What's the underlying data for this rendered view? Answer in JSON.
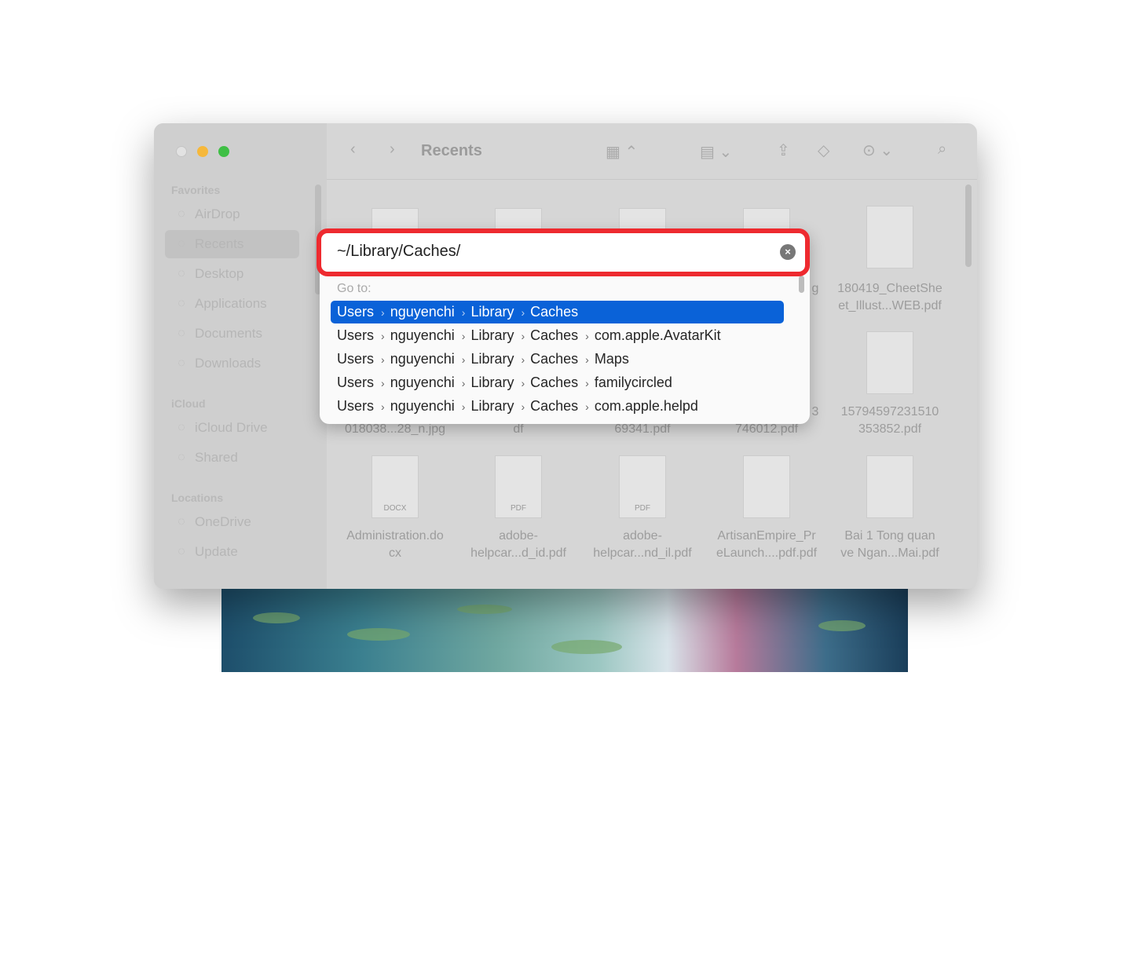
{
  "window": {
    "title": "Recents"
  },
  "sidebar": {
    "sections": [
      {
        "label": "Favorites",
        "items": [
          {
            "label": "AirDrop",
            "icon": "airdrop-icon"
          },
          {
            "label": "Recents",
            "icon": "clock-icon",
            "selected": true
          },
          {
            "label": "Desktop",
            "icon": "desktop-icon"
          },
          {
            "label": "Applications",
            "icon": "applications-icon"
          },
          {
            "label": "Documents",
            "icon": "document-icon"
          },
          {
            "label": "Downloads",
            "icon": "download-icon"
          }
        ]
      },
      {
        "label": "iCloud",
        "items": [
          {
            "label": "iCloud Drive",
            "icon": "cloud-icon"
          },
          {
            "label": "Shared",
            "icon": "shared-folder-icon"
          }
        ]
      },
      {
        "label": "Locations",
        "items": [
          {
            "label": "OneDrive",
            "icon": "cloud-icon"
          },
          {
            "label": "Update",
            "icon": "drive-icon"
          }
        ]
      }
    ]
  },
  "files": {
    "row1": [
      {
        "name": "180419_CheetShe\net_Illust...WEB.pdf"
      }
    ],
    "row1_partial": "g",
    "row2": [
      {
        "name": "018038...28_n.jpg"
      },
      {
        "name": "df"
      },
      {
        "name": "69341.pdf"
      },
      {
        "name": "746012.pdf"
      },
      {
        "name": "15794597231510\n353852.pdf"
      }
    ],
    "row2_partial": "3",
    "row3": [
      {
        "name": "Administration.do\ncx",
        "badge": "DOCX"
      },
      {
        "name": "adobe-\nhelpcar...d_id.pdf",
        "badge": "PDF"
      },
      {
        "name": "adobe-\nhelpcar...nd_il.pdf",
        "badge": "PDF"
      },
      {
        "name": "ArtisanEmpire_Pr\neLaunch....pdf.pdf"
      },
      {
        "name": "Bai 1 Tong quan\nve Ngan...Mai.pdf"
      }
    ]
  },
  "goto": {
    "value": "~/Library/Caches/",
    "label": "Go to:",
    "suggestions": [
      [
        "Users",
        "nguyenchi",
        "Library",
        "Caches"
      ],
      [
        "Users",
        "nguyenchi",
        "Library",
        "Caches",
        "com.apple.AvatarKit"
      ],
      [
        "Users",
        "nguyenchi",
        "Library",
        "Caches",
        "Maps"
      ],
      [
        "Users",
        "nguyenchi",
        "Library",
        "Caches",
        "familycircled"
      ],
      [
        "Users",
        "nguyenchi",
        "Library",
        "Caches",
        "com.apple.helpd"
      ]
    ],
    "highlight_color": "#ee2a2f",
    "selection_color": "#0a62d8"
  }
}
